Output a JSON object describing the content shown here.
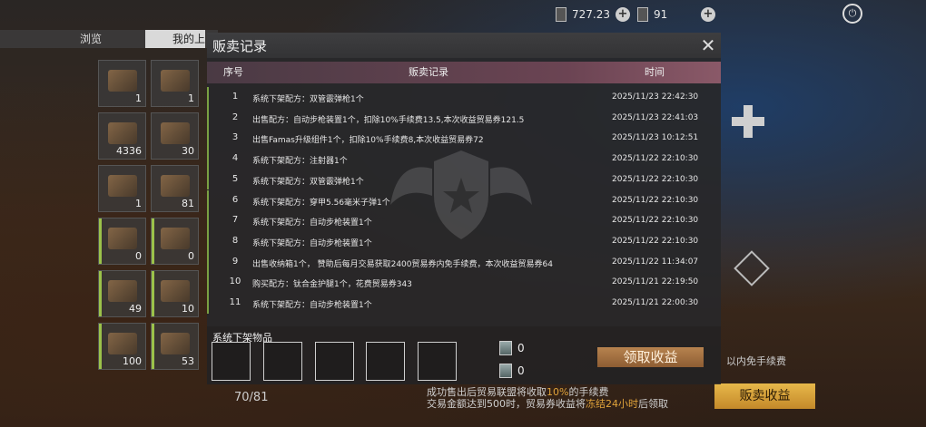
{
  "top_bar": {
    "currency1": "727.23",
    "currency2": "91"
  },
  "bg_tabs": {
    "browse": "浏览",
    "mine": "我的上"
  },
  "inventory": {
    "counts": [
      "1",
      "1",
      "4336",
      "30",
      "1",
      "81",
      "0",
      "0",
      "49",
      "10",
      "100",
      "53"
    ],
    "total": "70/81"
  },
  "background_right": {
    "free_fee_text": "以内免手续费",
    "sell_income_button": "贩卖收益"
  },
  "modal": {
    "title": "贩卖记录",
    "close_icon": "close-icon",
    "columns": {
      "no": "序号",
      "record": "贩卖记录",
      "time": "时间"
    },
    "rows": [
      {
        "no": "1",
        "record": "系统下架配方：双管霰弹枪1个",
        "time": "2025/11/23 22:42:30"
      },
      {
        "no": "2",
        "record": "出售配方：自动步枪装置1个，扣除10%手续费13.5,本次收益贸易券121.5",
        "time": "2025/11/23 22:41:03"
      },
      {
        "no": "3",
        "record": "出售Famas升级组件1个，扣除10%手续费8,本次收益贸易券72",
        "time": "2025/11/23 10:12:51"
      },
      {
        "no": "4",
        "record": "系统下架配方：注射器1个",
        "time": "2025/11/22 22:10:30"
      },
      {
        "no": "5",
        "record": "系统下架配方：双管霰弹枪1个",
        "time": "2025/11/22 22:10:30"
      },
      {
        "no": "6",
        "record": "系统下架配方：穿甲5.56毫米子弹1个",
        "time": "2025/11/22 22:10:30"
      },
      {
        "no": "7",
        "record": "系统下架配方：自动步枪装置1个",
        "time": "2025/11/22 22:10:30"
      },
      {
        "no": "8",
        "record": "系统下架配方：自动步枪装置1个",
        "time": "2025/11/22 22:10:30"
      },
      {
        "no": "9",
        "record": "出售收纳箱1个，  赞助后每月交易获取2400贸易券内免手续费，本次收益贸易券64",
        "time": "2025/11/22 11:34:07"
      },
      {
        "no": "10",
        "record": "购买配方：钛合金护腿1个，花费贸易券343",
        "time": "2025/11/21 22:19:50"
      },
      {
        "no": "11",
        "record": "系统下架配方：自动步枪装置1个",
        "time": "2025/11/21 22:00:30"
      }
    ]
  },
  "lower_panel": {
    "title": "系统下架物品",
    "token1": "0",
    "token2": "0",
    "claim_button": "领取收益"
  },
  "notice": {
    "line1_prefix": "成功售出后贸易联盟将收取",
    "line1_highlight": "10%",
    "line1_suffix": "的手续费",
    "line2_prefix": "交易金额达到500时，贸易券收益将",
    "line2_highlight": "冻结24小时",
    "line2_suffix": "后领取"
  }
}
